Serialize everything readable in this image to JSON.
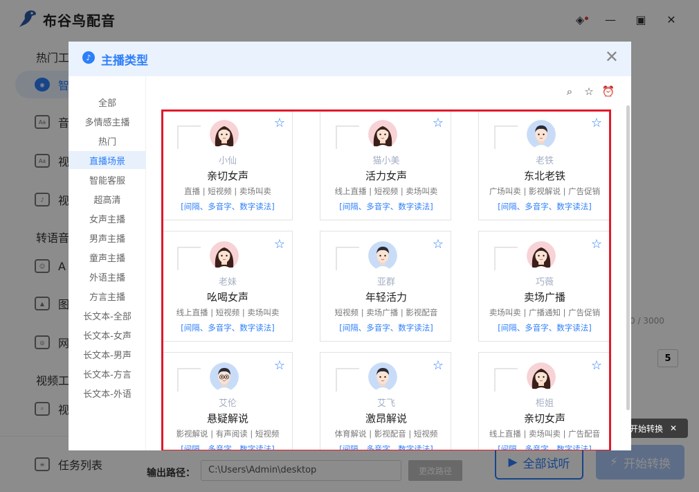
{
  "app": {
    "title": "布谷鸟配音",
    "window_controls": [
      "layers-icon",
      "minimize-icon",
      "maximize-icon",
      "close-icon"
    ]
  },
  "sidebar": {
    "sections": [
      {
        "label": "热门工"
      },
      {
        "label": "转语音"
      },
      {
        "label": "视频工"
      }
    ],
    "items": [
      {
        "label": "智",
        "active": true
      },
      {
        "label": "音"
      },
      {
        "label": "视"
      },
      {
        "label": "视"
      },
      {
        "label": "A"
      },
      {
        "label": "图"
      },
      {
        "label": "网"
      },
      {
        "label": "视"
      }
    ],
    "task_list": "任务列表"
  },
  "main": {
    "output_label": "输出路径：",
    "output_path": "C:\\Users\\Admin\\desktop",
    "change_path": "更改路径",
    "listen_all": "全部试听",
    "start_convert": "开始转换",
    "tooltip": "开始转换",
    "char_count": "0 / 3000",
    "number_value": "5"
  },
  "modal": {
    "title": "主播类型",
    "categories": [
      {
        "label": "全部"
      },
      {
        "label": "多情感主播"
      },
      {
        "label": "热门"
      },
      {
        "label": "直播场景",
        "active": true
      },
      {
        "label": "智能客服"
      },
      {
        "label": "超高清"
      },
      {
        "label": "女声主播"
      },
      {
        "label": "男声主播"
      },
      {
        "label": "童声主播"
      },
      {
        "label": "外语主播"
      },
      {
        "label": "方言主播"
      },
      {
        "label": "长文本-全部"
      },
      {
        "label": "长文本-女声"
      },
      {
        "label": "长文本-男声"
      },
      {
        "label": "长文本-方言"
      },
      {
        "label": "长文本-外语"
      }
    ],
    "tools": [
      "search-icon",
      "star-icon",
      "alarm-clock-icon"
    ],
    "voices": [
      {
        "name": "小仙",
        "style": "亲切女声",
        "tags": "直播 | 短视频 | 卖场叫卖",
        "features": "[间隔、多音字、数字读法]",
        "gender": "female"
      },
      {
        "name": "猫小美",
        "style": "活力女声",
        "tags": "线上直播 | 短视频 | 卖场叫卖",
        "features": "[间隔、多音字、数字读法]",
        "gender": "female"
      },
      {
        "name": "老铁",
        "style": "东北老铁",
        "tags": "广场叫卖 | 影视解说 | 广告促销",
        "features": "[间隔、多音字、数字读法]",
        "gender": "male"
      },
      {
        "name": "老妹",
        "style": "吆喝女声",
        "tags": "线上直播 | 短视频 | 卖场叫卖",
        "features": "[间隔、多音字、数字读法]",
        "gender": "female"
      },
      {
        "name": "亚群",
        "style": "年轻活力",
        "tags": "短视频 | 卖场广播 | 影视配音",
        "features": "[间隔、多音字、数字读法]",
        "gender": "male"
      },
      {
        "name": "巧薇",
        "style": "卖场广播",
        "tags": "卖场叫卖 | 广播通知 | 广告促销",
        "features": "[间隔、多音字、数字读法]",
        "gender": "female"
      },
      {
        "name": "艾伦",
        "style": "悬疑解说",
        "tags": "影视解说 | 有声阅读 | 短视频",
        "features": "[间隔、多音字、数字读法]",
        "gender": "male-glasses"
      },
      {
        "name": "艾飞",
        "style": "激昂解说",
        "tags": "体育解说 | 影视配音 | 短视频",
        "features": "[间隔、多音字、数字读法]",
        "gender": "male"
      },
      {
        "name": "柜姐",
        "style": "亲切女声",
        "tags": "线上直播 | 卖场叫卖 | 广告配音",
        "features": "[间隔、多音字、数字读法]",
        "gender": "female"
      }
    ]
  }
}
